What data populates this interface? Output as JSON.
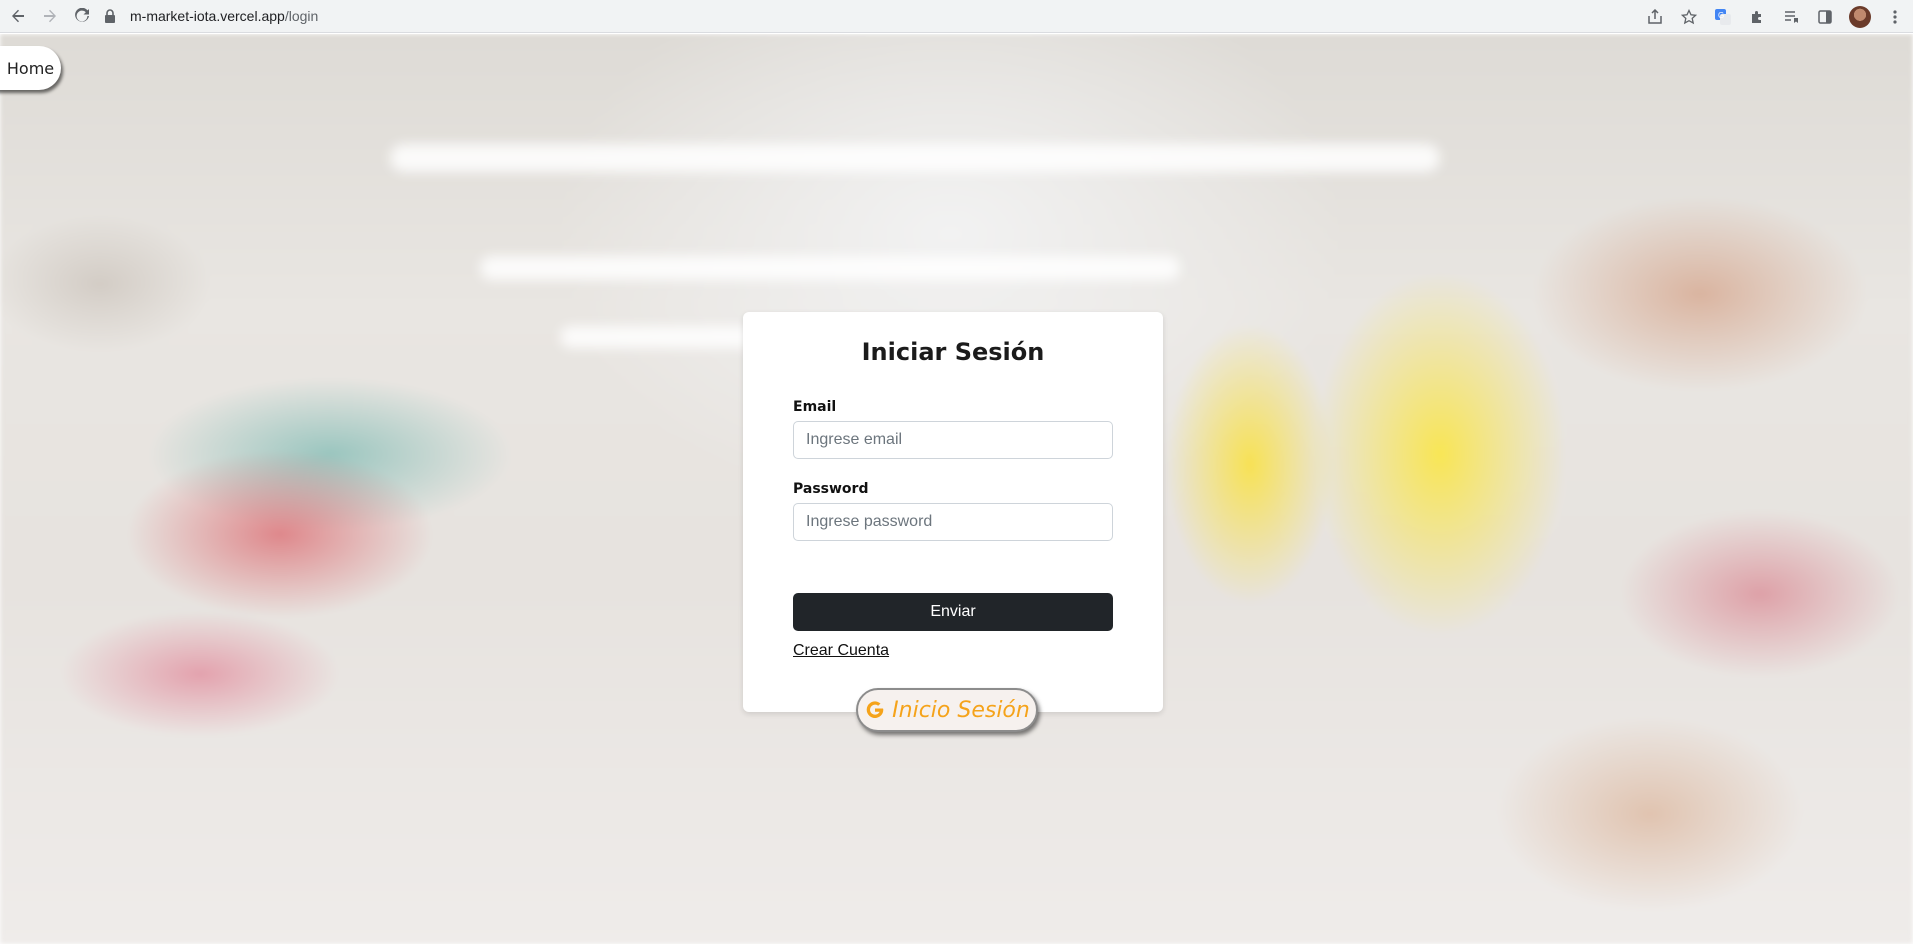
{
  "browser": {
    "url_host": "m-market-iota.vercel.app",
    "url_path": "/login"
  },
  "nav": {
    "home_label": "Home"
  },
  "login": {
    "title": "Iniciar Sesión",
    "email_label": "Email",
    "email_placeholder": "Ingrese email",
    "email_value": "",
    "password_label": "Password",
    "password_placeholder": "Ingrese password",
    "password_value": "",
    "submit_label": "Enviar",
    "create_account_label": "Crear Cuenta",
    "google_label": "Inicio Sesión"
  },
  "colors": {
    "submit_bg": "#212529",
    "google_text": "#f5a31a"
  }
}
